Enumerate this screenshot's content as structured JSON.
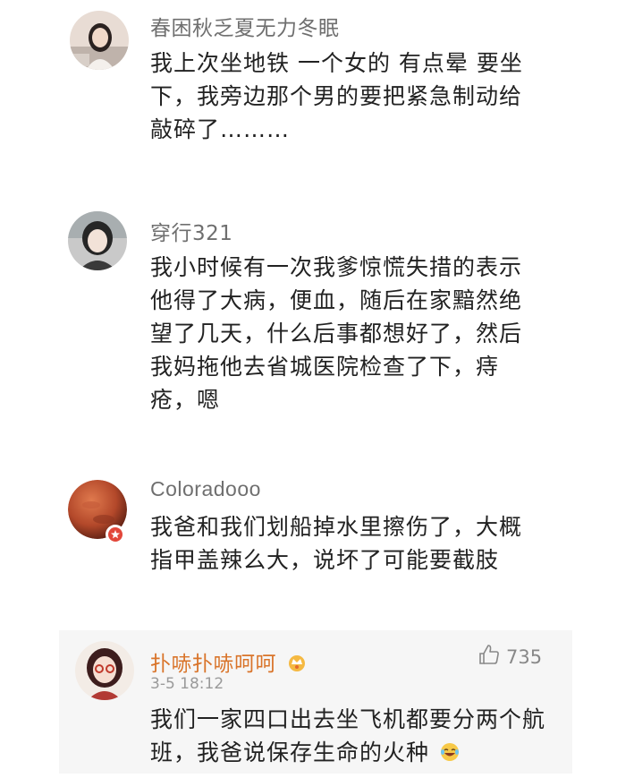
{
  "comments": [
    {
      "username": "春困秋乏夏无力冬眠",
      "lines": [
        "我上次坐地铁 一个女的 有点晕 要坐",
        "下，我旁边那个男的要把紧急制动给",
        "敲碎了………"
      ]
    },
    {
      "username": "穿行321",
      "lines": [
        "我小时候有一次我爹惊慌失措的表示",
        "他得了大病，便血，随后在家黯然绝",
        "望了几天，什么后事都想好了，然后",
        "我妈拖他去省城医院检查了下，痔",
        "疮，嗯"
      ]
    },
    {
      "username": "Coloradooo",
      "lines": [
        "我爸和我们划船掉水里擦伤了，大概",
        "指甲盖辣么大，说坏了可能要截肢"
      ]
    },
    {
      "username": "扑哧扑哧呵呵",
      "timestamp": "3-5 18:12",
      "likes": "735",
      "lines": [
        "我们一家四口出去坐飞机都要分两个航",
        "班，我爸说保存生命的火种"
      ]
    }
  ],
  "icons": {
    "crown": "crown-badge-icon",
    "like": "thumbs-up-icon",
    "emoji": "laughing-emoji-icon",
    "vip": "vip-badge-icon"
  },
  "colors": {
    "username": "#6f6f6f",
    "username_highlight": "#d9742a",
    "text": "#222222",
    "meta": "#9a9a9a",
    "panel_bg": "#f6f6f6"
  }
}
